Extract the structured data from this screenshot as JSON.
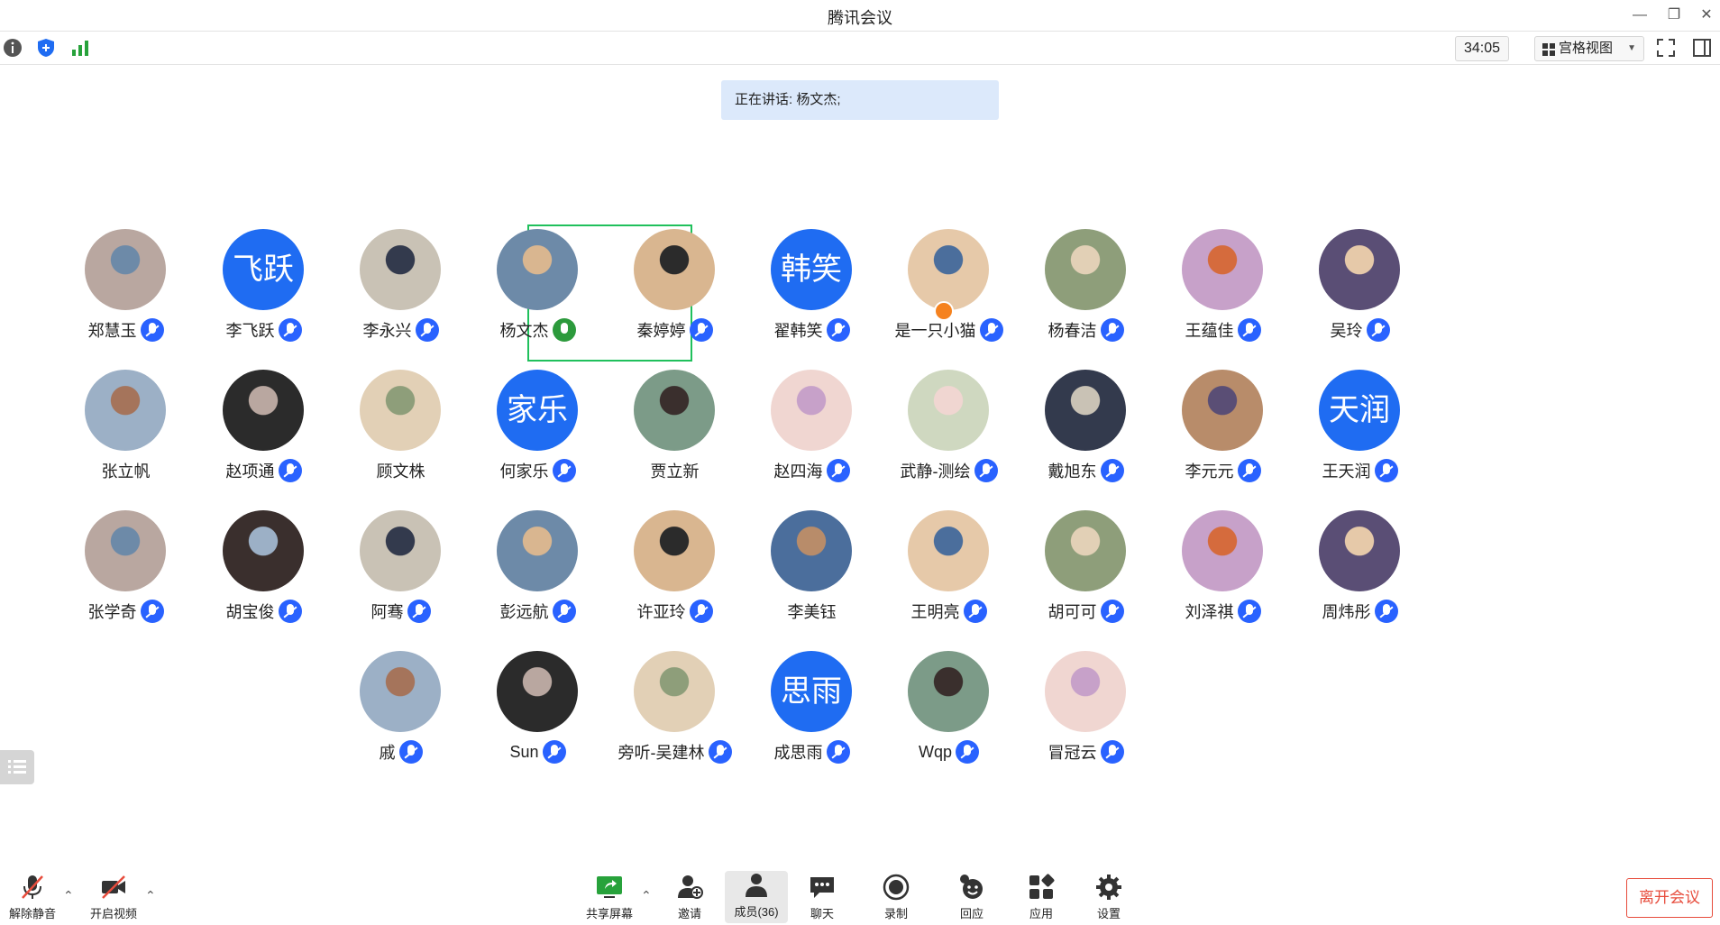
{
  "window": {
    "title": "腾讯会议"
  },
  "toolbar": {
    "timer": "34:05",
    "view_label": "宫格视图"
  },
  "speaking": "正在讲话: 杨文杰;",
  "participants": [
    {
      "name": "郑慧玉"
    },
    {
      "name": "李飞跃",
      "avatar_text": "飞跃"
    },
    {
      "name": "李永兴"
    },
    {
      "name": "杨文杰"
    },
    {
      "name": "秦婷婷"
    },
    {
      "name": "翟韩笑",
      "avatar_text": "韩笑"
    },
    {
      "name": "是一只小猫"
    },
    {
      "name": "杨春洁"
    },
    {
      "name": "王蕴佳"
    },
    {
      "name": "吴玲"
    },
    {
      "name": "张立帆"
    },
    {
      "name": "赵项通"
    },
    {
      "name": "顾文株"
    },
    {
      "name": "何家乐",
      "avatar_text": "家乐"
    },
    {
      "name": "贾立新"
    },
    {
      "name": "赵四海"
    },
    {
      "name": "武静-测绘"
    },
    {
      "name": "戴旭东"
    },
    {
      "name": "李元元"
    },
    {
      "name": "王天润",
      "avatar_text": "天润"
    },
    {
      "name": "张学奇"
    },
    {
      "name": "胡宝俊"
    },
    {
      "name": "阿骞"
    },
    {
      "name": "彭远航"
    },
    {
      "name": "许亚玲"
    },
    {
      "name": "李美钰"
    },
    {
      "name": "王明亮"
    },
    {
      "name": "胡可可"
    },
    {
      "name": "刘泽祺"
    },
    {
      "name": "周炜彤"
    },
    {
      "name": "戚"
    },
    {
      "name": "Sun"
    },
    {
      "name": "旁听-吴建林"
    },
    {
      "name": "成思雨",
      "avatar_text": "思雨"
    },
    {
      "name": "Wqp"
    },
    {
      "name": "冒冠云"
    }
  ],
  "bottom": {
    "unmute": "解除静音",
    "video": "开启视频",
    "share": "共享屏幕",
    "invite": "邀请",
    "members": "成员(36)",
    "chat": "聊天",
    "record": "录制",
    "reaction": "回应",
    "apps": "应用",
    "settings": "设置",
    "leave": "离开会议"
  },
  "colors": {
    "accent": "#1f6cf2",
    "mic_active": "#2c9a3c",
    "leave": "#e74c3c",
    "highlight": "#20c05c"
  }
}
